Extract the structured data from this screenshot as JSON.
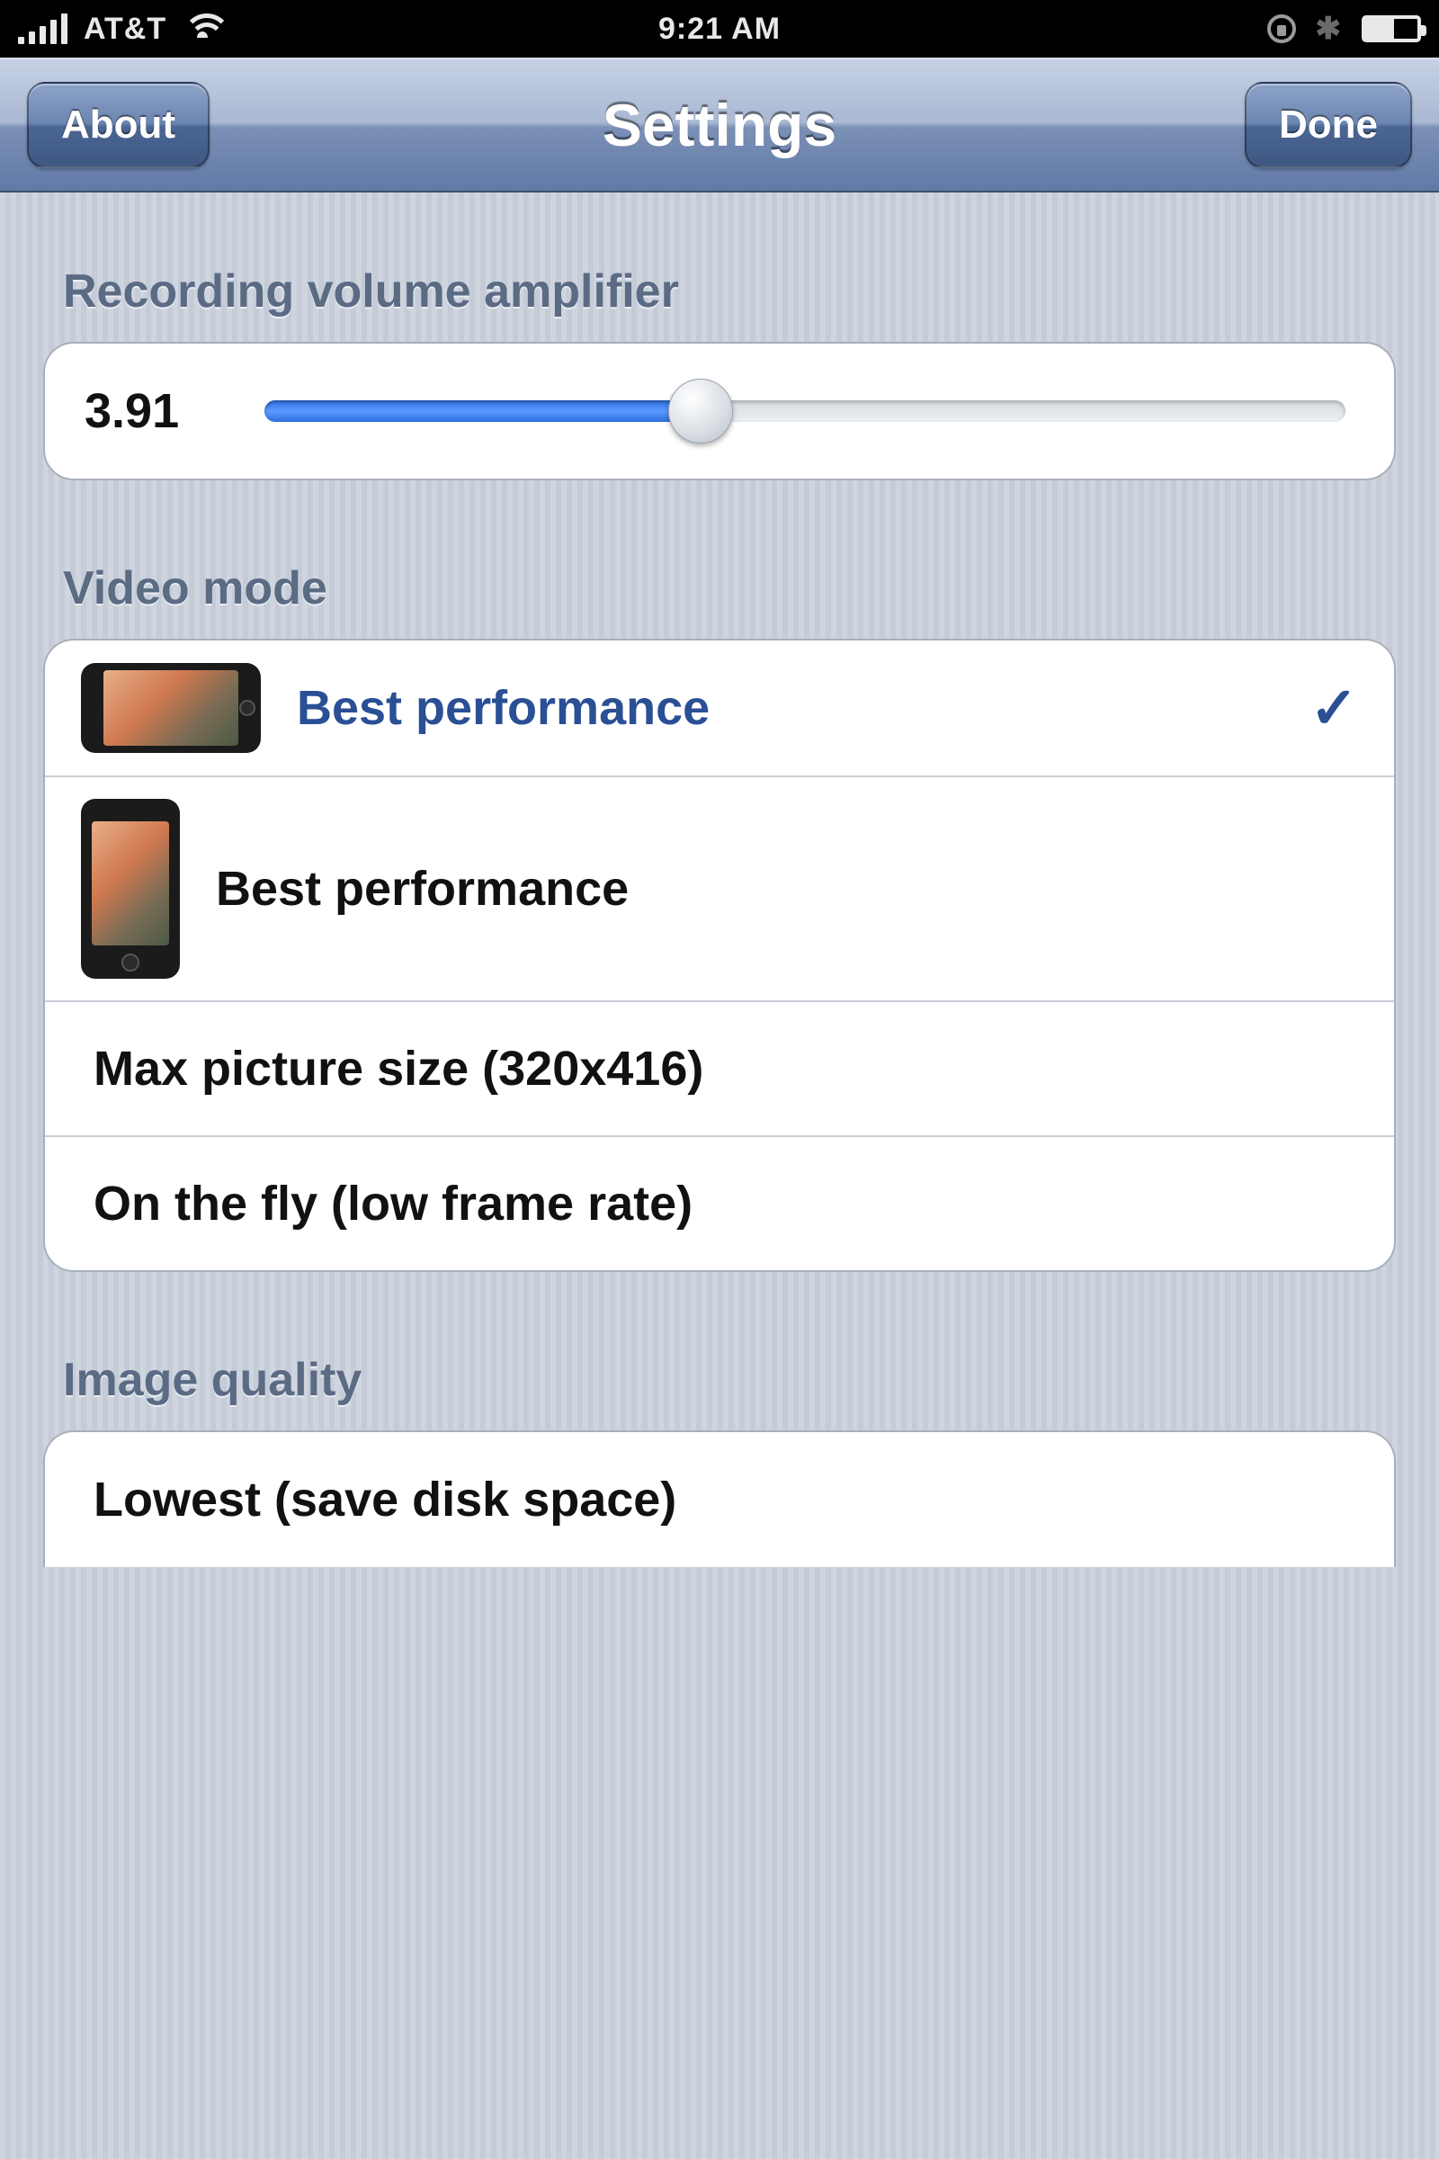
{
  "statusbar": {
    "carrier": "AT&T",
    "time": "9:21 AM",
    "bluetooth_glyph": "✱"
  },
  "nav": {
    "left_label": "About",
    "title": "Settings",
    "right_label": "Done"
  },
  "sections": {
    "amplifier": {
      "header": "Recording volume amplifier",
      "value": "3.91",
      "slider_percent": 40
    },
    "video_mode": {
      "header": "Video mode",
      "options": [
        {
          "label": "Best performance",
          "selected": true,
          "icon": "landscape"
        },
        {
          "label": "Best performance",
          "selected": false,
          "icon": "portrait"
        },
        {
          "label": "Max picture size (320x416)",
          "selected": false,
          "icon": null
        },
        {
          "label": "On the fly (low frame rate)",
          "selected": false,
          "icon": null
        }
      ]
    },
    "image_quality": {
      "header": "Image quality",
      "options": [
        {
          "label": "Lowest (save disk space)",
          "selected": false
        }
      ]
    }
  },
  "checkmark_glyph": "✓"
}
